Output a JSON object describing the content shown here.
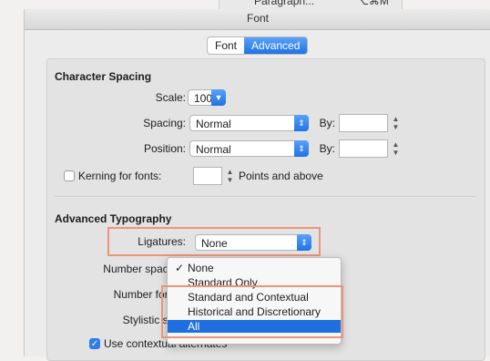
{
  "background_menu": {
    "item": "Paragraph...",
    "shortcut": "⌥⌘M"
  },
  "window": {
    "title": "Font"
  },
  "tabs": {
    "font": "Font",
    "advanced": "Advanced"
  },
  "character_spacing": {
    "heading": "Character Spacing",
    "scale_label": "Scale:",
    "scale_value": "100%",
    "spacing_label": "Spacing:",
    "spacing_value": "Normal",
    "spacing_by_label": "By:",
    "position_label": "Position:",
    "position_value": "Normal",
    "position_by_label": "By:",
    "kerning_label": "Kerning for fonts:",
    "kerning_suffix": "Points and above"
  },
  "advanced_typography": {
    "heading": "Advanced Typography",
    "ligatures_label": "Ligatures:",
    "ligatures_value": "None",
    "number_spacing_label": "Number spacing:",
    "number_forms_label": "Number forms:",
    "stylistic_sets_label": "Stylistic sets:",
    "contextual_label": "Use contextual alternates"
  },
  "ligatures_menu": {
    "options": [
      "None",
      "Standard Only",
      "Standard and Contextual",
      "Historical and Discretionary",
      "All"
    ],
    "checked": "None",
    "highlighted": "All"
  },
  "colors": {
    "accent": "#1f6fe0",
    "highlight_border": "#e9967a"
  }
}
